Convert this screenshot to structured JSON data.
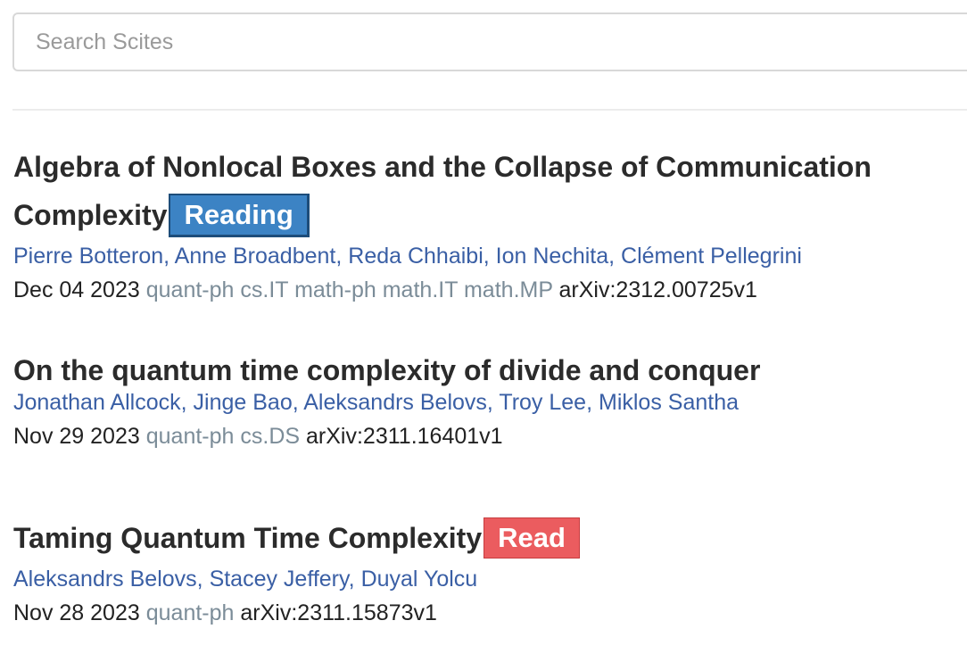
{
  "search": {
    "placeholder": "Search Scites"
  },
  "papers": [
    {
      "title_parts": [
        "Algebra of Nonlocal Boxes and the Collapse of Communication",
        "Complexity"
      ],
      "badge": {
        "label": "Reading",
        "color": "#3c83c4"
      },
      "authors": [
        "Pierre Botteron",
        "Anne Broadbent",
        "Reda Chhaibi",
        "Ion Nechita",
        "Clément Pellegrini"
      ],
      "date": "Dec 04 2023",
      "categories": [
        "quant-ph",
        "cs.IT",
        "math-ph",
        "math.IT",
        "math.MP"
      ],
      "arxiv_id": "arXiv:2312.00725v1"
    },
    {
      "title_parts": [
        "On the quantum time complexity of divide and conquer"
      ],
      "badge": null,
      "authors": [
        "Jonathan Allcock",
        "Jinge Bao",
        "Aleksandrs Belovs",
        "Troy Lee",
        "Miklos Santha"
      ],
      "date": "Nov 29 2023",
      "categories": [
        "quant-ph",
        "cs.DS"
      ],
      "arxiv_id": "arXiv:2311.16401v1"
    },
    {
      "title_parts": [
        "Taming Quantum Time Complexity"
      ],
      "badge": {
        "label": "Read",
        "color": "#eb5c5f"
      },
      "authors": [
        "Aleksandrs Belovs",
        "Stacey Jeffery",
        "Duyal Yolcu"
      ],
      "date": "Nov 28 2023",
      "categories": [
        "quant-ph"
      ],
      "arxiv_id": "arXiv:2311.15873v1"
    }
  ]
}
